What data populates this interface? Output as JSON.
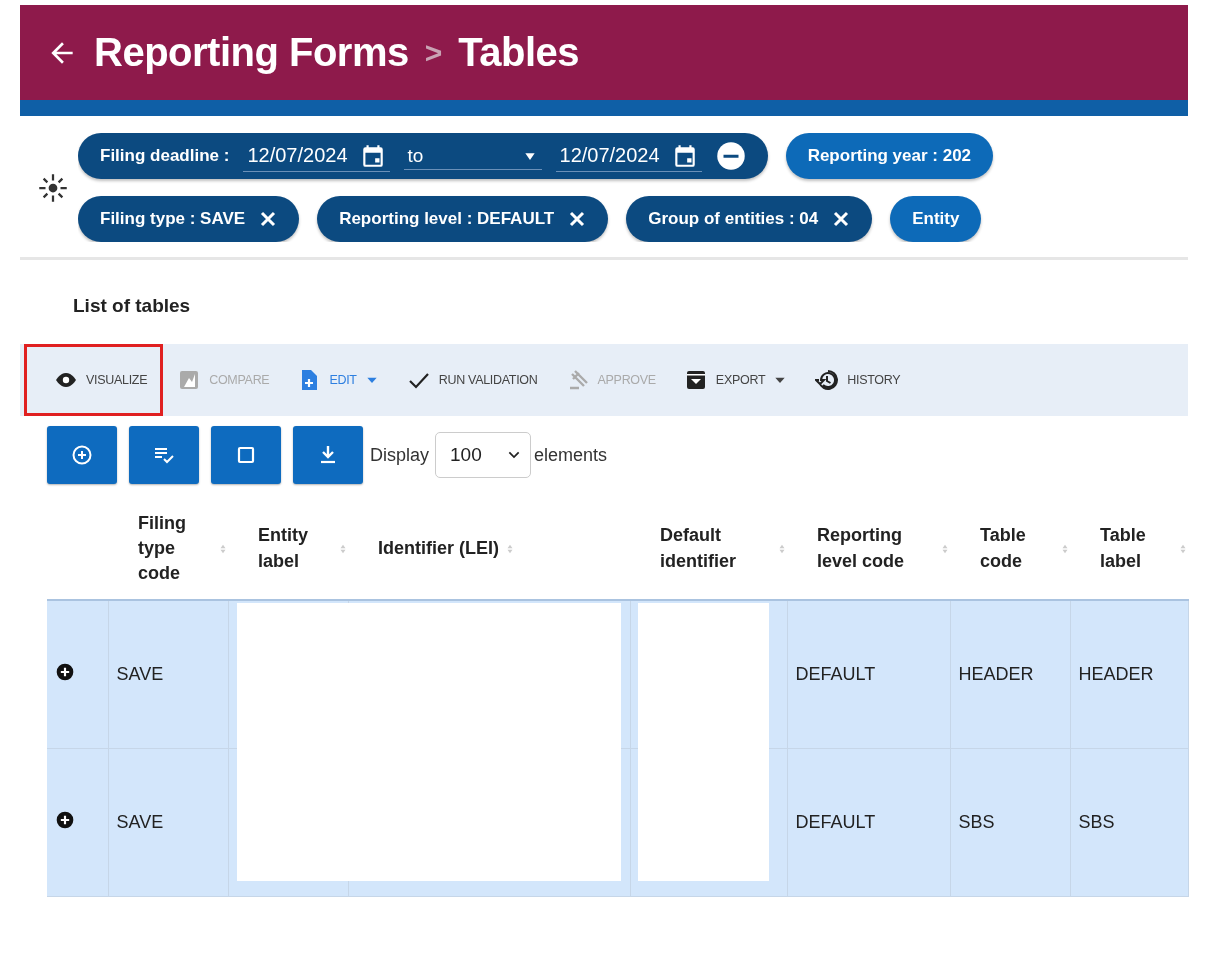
{
  "header": {
    "breadcrumb": [
      "Reporting Forms",
      "Tables"
    ],
    "separator": ">"
  },
  "filters": [
    {
      "kind": "date_range",
      "label": "Filing deadline :",
      "from": "12/07/2024",
      "connector": "to",
      "to": "12/07/2024",
      "active": true
    },
    {
      "kind": "chip",
      "label": "Reporting year : 202",
      "active": false,
      "removable": false
    },
    {
      "kind": "chip",
      "label": "Filing type : SAVE",
      "active": true,
      "removable": true
    },
    {
      "kind": "chip",
      "label": "Reporting level : DEFAULT",
      "active": true,
      "removable": true
    },
    {
      "kind": "chip",
      "label": "Group of entities : 04",
      "active": true,
      "removable": true
    },
    {
      "kind": "chip",
      "label": "Entity",
      "active": false,
      "removable": false
    }
  ],
  "section_title": "List of tables",
  "toolbar": [
    {
      "kind": "eye",
      "label": "VISUALIZE",
      "disabled": false,
      "dropdown": false,
      "highlighted": true
    },
    {
      "kind": "compare",
      "label": "COMPARE",
      "disabled": true,
      "dropdown": false,
      "highlighted": false
    },
    {
      "kind": "file-add",
      "label": "EDIT",
      "disabled": false,
      "dropdown": true,
      "highlighted": false,
      "accent": true
    },
    {
      "kind": "check",
      "label": "RUN VALIDATION",
      "disabled": false,
      "dropdown": false,
      "highlighted": false
    },
    {
      "kind": "gavel",
      "label": "APPROVE",
      "disabled": true,
      "dropdown": false,
      "highlighted": false
    },
    {
      "kind": "archive",
      "label": "EXPORT",
      "disabled": false,
      "dropdown": true,
      "highlighted": false
    },
    {
      "kind": "history",
      "label": "HISTORY",
      "disabled": false,
      "dropdown": false,
      "highlighted": false
    }
  ],
  "actions": [
    {
      "kind": "add"
    },
    {
      "kind": "checklist"
    },
    {
      "kind": "square"
    },
    {
      "kind": "download"
    }
  ],
  "display": {
    "before": "Display",
    "value": "100",
    "after": "elements"
  },
  "table": {
    "columns": [
      "Filing type code",
      "Entity label",
      "Identifier (LEI)",
      "Default identifier",
      "Reporting level code",
      "Table code",
      "Table label"
    ],
    "redacted": true,
    "rows": [
      {
        "selected": true,
        "cells": [
          "SAVE",
          "",
          "",
          "",
          "DEFAULT",
          "HEADER",
          "HEADER"
        ]
      },
      {
        "selected": true,
        "cells": [
          "SAVE",
          "",
          "",
          "",
          "DEFAULT",
          "SBS",
          "SBS"
        ]
      }
    ]
  }
}
